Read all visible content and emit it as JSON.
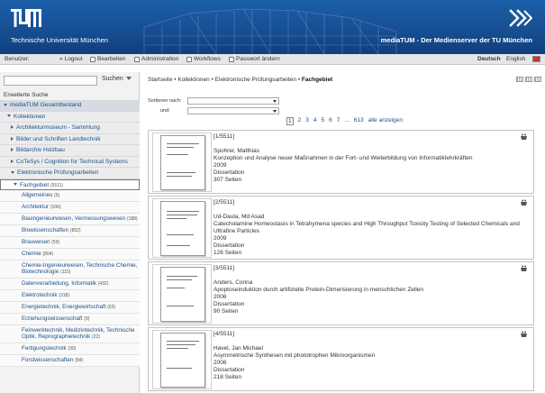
{
  "header": {
    "university": "Technische Universität München",
    "media_title": "mediaTUM - Der Medienserver der TU München"
  },
  "userbar": {
    "user_label": "Benutzer:",
    "logout": "Logout",
    "edit": "Bearbeiten",
    "admin": "Administration",
    "workflows": "Workflows",
    "password": "Passwort ändern",
    "lang_de": "Deutsch",
    "lang_en": "English"
  },
  "sidebar": {
    "search_button": "Suchen",
    "advanced_search": "Erweiterte Suche",
    "root": "mediaTUM Gesamtbestand",
    "collections": "Kollektionen",
    "items": [
      {
        "label": "Architekturmuseum - Sammlung"
      },
      {
        "label": "Bilder und Schriften Landtechnik"
      },
      {
        "label": "Bildarchiv Holzbau"
      },
      {
        "label": "CoTeSys / Cognition for Technical Systems"
      },
      {
        "label": "Elektronische Prüfungsarbeiten"
      }
    ],
    "fachgebiet": {
      "label": "Fachgebiet",
      "count": "(5511)"
    },
    "subjects": [
      {
        "label": "Allgemeines",
        "count": "(5)"
      },
      {
        "label": "Architektur",
        "count": "(106)"
      },
      {
        "label": "Bauingenieurwesen, Vermessungswesen",
        "count": "(188)"
      },
      {
        "label": "Biowissenschaften",
        "count": "(852)"
      },
      {
        "label": "Brauwesen",
        "count": "(59)"
      },
      {
        "label": "Chemie",
        "count": "(804)"
      },
      {
        "label": "Chemie-Ingenieurwesen, Technische Chemie, Biotechnologie",
        "count": "(115)"
      },
      {
        "label": "Datenverarbeitung, Informatik",
        "count": "(432)"
      },
      {
        "label": "Elektrotechnik",
        "count": "(318)"
      },
      {
        "label": "Energietechnik, Energiewirtschaft",
        "count": "(63)"
      },
      {
        "label": "Erziehungswissenschaft",
        "count": "(9)"
      },
      {
        "label": "Feinwerktechnik, Medizintechnik, Technische Optik, Reprographietechnik",
        "count": "(22)"
      },
      {
        "label": "Fertigungstechnik",
        "count": "(30)"
      },
      {
        "label": "Forstwissenschaften",
        "count": "(84)"
      }
    ]
  },
  "main": {
    "breadcrumb": [
      "Startseite",
      "Kollektionen",
      "Elektronische Prüfungsarbeiten"
    ],
    "breadcrumb_current": "Fachgebiet",
    "sort_label": "Sortieren nach:",
    "sort_and": "und:",
    "pager": {
      "current": "1",
      "pages": [
        "2",
        "3",
        "4",
        "5",
        "6",
        "7",
        "..."
      ],
      "last": "613",
      "all": "alle anzeigen"
    },
    "results": [
      {
        "index": "[1/5511]",
        "author": "Spohrer, Matthias",
        "title": "Konzeption und Analyse neuer Maßnahmen in der Fort- und Weiterbildung von Informatiklehrkräften",
        "year": "2009",
        "type": "Dissertation",
        "pages": "307 Seiten"
      },
      {
        "index": "[2/5511]",
        "author": "Ud-Daula, Md Asad",
        "title": "Catecholamine Homeostasis in Tetrahymena species and High Throughput Toxicity Testing of Selected Chemicals and Ultrafine Particles",
        "year": "2009",
        "type": "Dissertation",
        "pages": "126 Seiten"
      },
      {
        "index": "[3/5511]",
        "author": "Anders, Corina",
        "title": "Apoptoseinduktion durch artifizielle Protein-Dimerisierung in menschlichen Zellen",
        "year": "2006",
        "type": "Dissertation",
        "pages": "90 Seiten"
      },
      {
        "index": "[4/5511]",
        "author": "Havel, Jan Michael",
        "title": "Asymmetrische Synthesen mit phototrophen Mikroorganismen",
        "year": "2006",
        "type": "Dissertation",
        "pages": "218 Seiten"
      }
    ]
  }
}
